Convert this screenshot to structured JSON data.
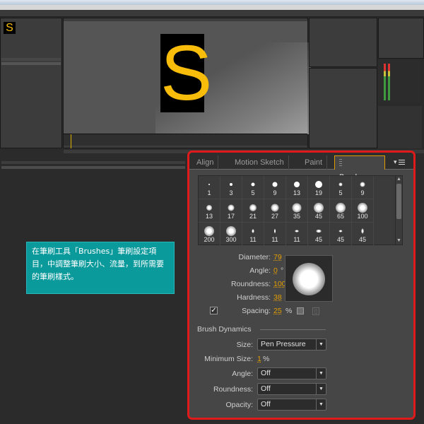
{
  "brushes_panel": {
    "tabs": [
      {
        "label": "Align"
      },
      {
        "label": "Motion Sketch"
      },
      {
        "label": "Paint"
      },
      {
        "label": "Brushes"
      }
    ],
    "menu_symbols": {
      "close": "×",
      "panel_menu": "▾≡"
    },
    "brush_tips": [
      {
        "size": "1"
      },
      {
        "size": "3"
      },
      {
        "size": "5"
      },
      {
        "size": "9"
      },
      {
        "size": "13"
      },
      {
        "size": "19"
      },
      {
        "size": "5"
      },
      {
        "size": "9"
      },
      {
        "size": "13"
      },
      {
        "size": "17"
      },
      {
        "size": "21"
      },
      {
        "size": "27"
      },
      {
        "size": "35"
      },
      {
        "size": "45"
      },
      {
        "size": "65"
      },
      {
        "size": "100"
      },
      {
        "size": "200"
      },
      {
        "size": "300"
      },
      {
        "size": "11"
      },
      {
        "size": "11"
      },
      {
        "size": "11"
      },
      {
        "size": "45"
      },
      {
        "size": "45"
      },
      {
        "size": "45"
      }
    ],
    "settings": {
      "diameter": {
        "label": "Diameter:",
        "value": "79",
        "unit": "px"
      },
      "angle": {
        "label": "Angle:",
        "value": "0",
        "unit": "°"
      },
      "roundness": {
        "label": "Roundness:",
        "value": "100",
        "unit": "%"
      },
      "hardness": {
        "label": "Hardness:",
        "value": "38",
        "unit": "%"
      },
      "spacing": {
        "label": "Spacing:",
        "value": "25",
        "unit": "%",
        "checked": true,
        "check_mark": "✓"
      }
    },
    "dynamics": {
      "title": "Brush Dynamics",
      "size": {
        "label": "Size:",
        "value": "Pen Pressure"
      },
      "minimum_size": {
        "label": "Minimum Size:",
        "value": "1",
        "unit": "%"
      },
      "angle": {
        "label": "Angle:",
        "value": "Off"
      },
      "roundness": {
        "label": "Roundness:",
        "value": "Off"
      },
      "opacity": {
        "label": "Opacity:",
        "value": "Off"
      }
    },
    "accent_color": "#e09b00",
    "highlight_border": "#e01a1a"
  },
  "caption": {
    "text": "在筆刷工具「Brushes」筆刷設定項目，中調整筆刷大小、流量，到所需要的筆刷樣式。",
    "color": "#0b9a9c"
  },
  "background_app": {
    "comp_letter": "S",
    "letter_color": "#f7bd0a"
  }
}
